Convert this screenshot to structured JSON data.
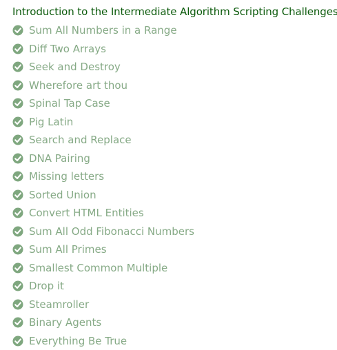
{
  "section": {
    "title": "Introduction to the Intermediate Algorithm Scripting Challenges"
  },
  "colors": {
    "title": "#0b5a0b",
    "item_text": "#86aa86",
    "check_circle": "#7fa77f",
    "check_mark": "#ffffff"
  },
  "challenges": [
    {
      "label": "Sum All Numbers in a Range",
      "completed": true,
      "icon": "check-circle-icon"
    },
    {
      "label": "Diff Two Arrays",
      "completed": true,
      "icon": "check-circle-icon"
    },
    {
      "label": "Seek and Destroy",
      "completed": true,
      "icon": "check-circle-icon"
    },
    {
      "label": "Wherefore art thou",
      "completed": true,
      "icon": "check-circle-icon"
    },
    {
      "label": "Spinal Tap Case",
      "completed": true,
      "icon": "check-circle-icon"
    },
    {
      "label": "Pig Latin",
      "completed": true,
      "icon": "check-circle-icon"
    },
    {
      "label": "Search and Replace",
      "completed": true,
      "icon": "check-circle-icon"
    },
    {
      "label": "DNA Pairing",
      "completed": true,
      "icon": "check-circle-icon"
    },
    {
      "label": "Missing letters",
      "completed": true,
      "icon": "check-circle-icon"
    },
    {
      "label": "Sorted Union",
      "completed": true,
      "icon": "check-circle-icon"
    },
    {
      "label": "Convert HTML Entities",
      "completed": true,
      "icon": "check-circle-icon"
    },
    {
      "label": "Sum All Odd Fibonacci Numbers",
      "completed": true,
      "icon": "check-circle-icon"
    },
    {
      "label": "Sum All Primes",
      "completed": true,
      "icon": "check-circle-icon"
    },
    {
      "label": "Smallest Common Multiple",
      "completed": true,
      "icon": "check-circle-icon"
    },
    {
      "label": "Drop it",
      "completed": true,
      "icon": "check-circle-icon"
    },
    {
      "label": "Steamroller",
      "completed": true,
      "icon": "check-circle-icon"
    },
    {
      "label": "Binary Agents",
      "completed": true,
      "icon": "check-circle-icon"
    },
    {
      "label": "Everything Be True",
      "completed": true,
      "icon": "check-circle-icon"
    }
  ]
}
